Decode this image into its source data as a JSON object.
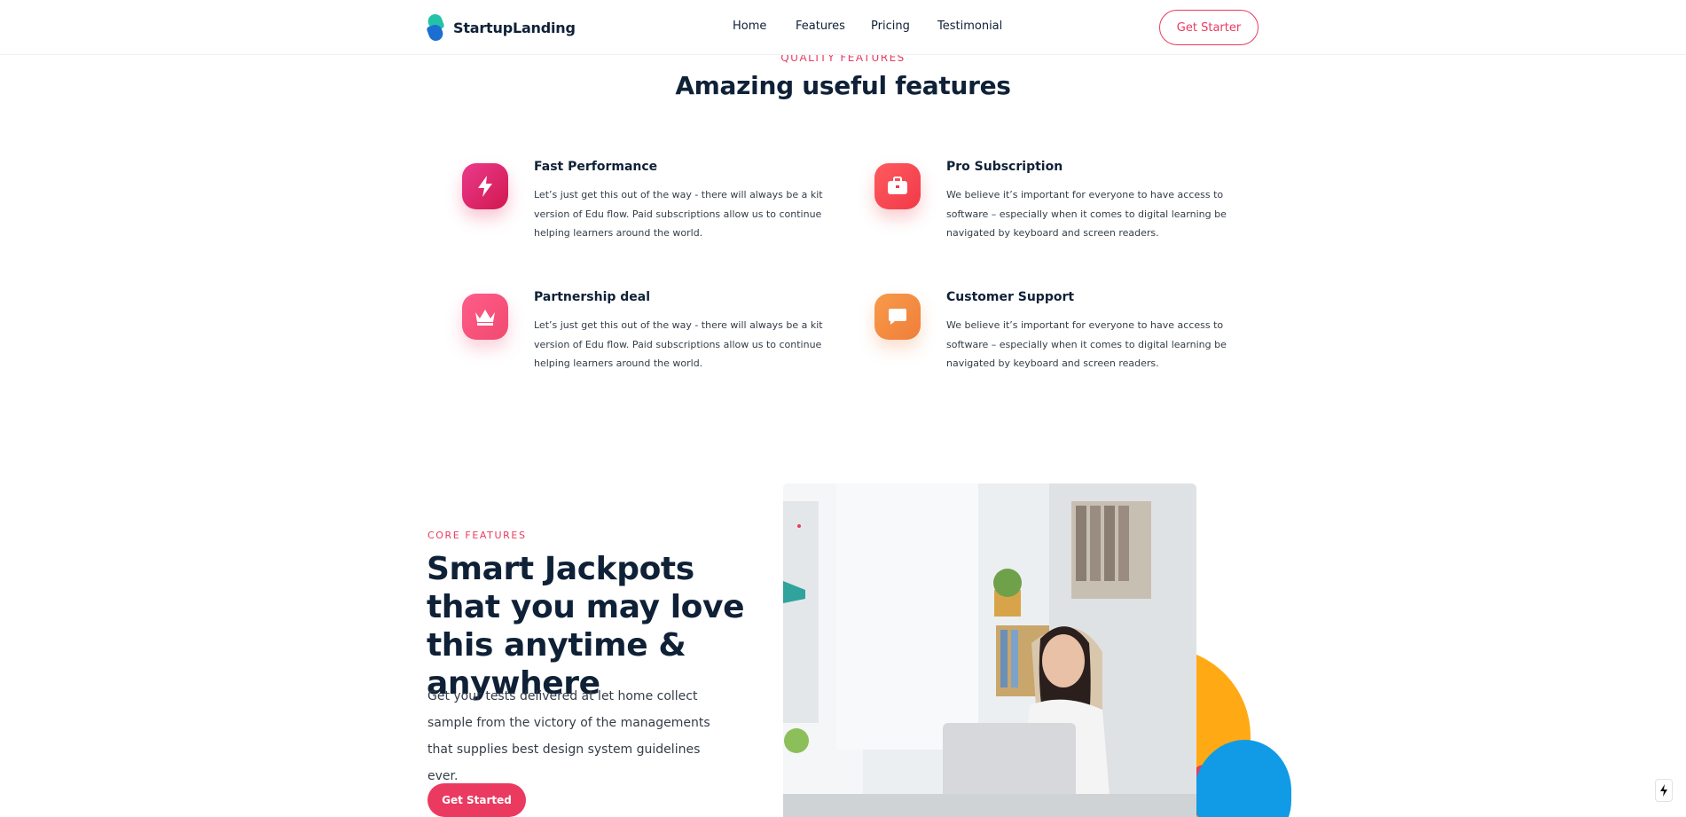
{
  "header": {
    "logo_text": "StartupLanding",
    "nav": [
      "Home",
      "Features",
      "Pricing",
      "Testimonial"
    ],
    "cta_label": "Get Starter"
  },
  "features_section": {
    "kicker": "QUALITY FEATURES",
    "title": "Amazing useful features",
    "items": [
      {
        "title": "Fast Performance",
        "text": "Let’s just get this out of the way - there will always be a kit version of Edu flow. Paid subscriptions allow us to continue helping learners around the world.",
        "icon": "lightning-icon"
      },
      {
        "title": "Pro Subscription",
        "text": "We believe it’s important for everyone to have access to software – especially when it comes to digital learning be navigated by keyboard and screen readers.",
        "icon": "briefcase-icon"
      },
      {
        "title": "Partnership deal",
        "text": "Let’s just get this out of the way - there will always be a kit version of Edu flow. Paid subscriptions allow us to continue helping learners around the world.",
        "icon": "crown-icon"
      },
      {
        "title": "Customer Support",
        "text": "We believe it’s important for everyone to have access to software – especially when it comes to digital learning be navigated by keyboard and screen readers.",
        "icon": "chat-icon"
      }
    ]
  },
  "core_section": {
    "kicker": "CORE FEATURES",
    "title": "Smart Jackpots that you may love this anytime & anywhere",
    "text": "Get your tests delivered at let home collect sample from the victory of the managements that supplies best design system guidelines ever.",
    "button_label": "Get Started"
  },
  "colors": {
    "accent": "#ea3a60",
    "heading": "#0f2137",
    "body": "#343d48",
    "blob_yellow": "#ffaa14",
    "blob_blue": "#119be6"
  }
}
